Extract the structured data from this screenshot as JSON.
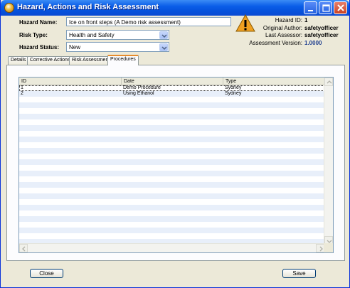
{
  "window": {
    "title": "Hazard, Actions and Risk Assessment"
  },
  "form": {
    "hazard_name_label": "Hazard Name:",
    "hazard_name_value": "Ice on front steps (A Demo risk assessment)",
    "risk_type_label": "Risk Type:",
    "risk_type_value": "Health and Safety",
    "hazard_status_label": "Hazard Status:",
    "hazard_status_value": "New"
  },
  "info": {
    "hazard_id_label": "Hazard ID:",
    "hazard_id_value": "1",
    "original_author_label": "Original Author:",
    "original_author_value": "safetyofficer",
    "last_assessor_label": "Last Assessor:",
    "last_assessor_value": "safetyofficer",
    "assessment_version_label": "Assessment Version:",
    "assessment_version_value": "1.0000"
  },
  "tabs": [
    {
      "label": "Details"
    },
    {
      "label": "Corrective Actions"
    },
    {
      "label": "Risk Assessment"
    },
    {
      "label": "Procedures",
      "active": true
    }
  ],
  "table": {
    "columns": [
      "ID",
      "Date",
      "Type"
    ],
    "rows": [
      [
        "1",
        "Demo Procedure",
        "Sydney"
      ],
      [
        "2",
        "Using Ethanol",
        "Sydney"
      ]
    ]
  },
  "buttons": {
    "close_label": "Close",
    "save_label": "Save"
  },
  "colors": {
    "titlebar": "#0a5de8",
    "stripe": "#e8effa",
    "assessment_version": "#1f3f8f",
    "warning": "#f0a020"
  },
  "icons": {
    "app": "app-icon",
    "warning": "warning-icon",
    "minimize": "minimize-icon",
    "maximize": "maximize-icon",
    "close": "close-icon"
  }
}
